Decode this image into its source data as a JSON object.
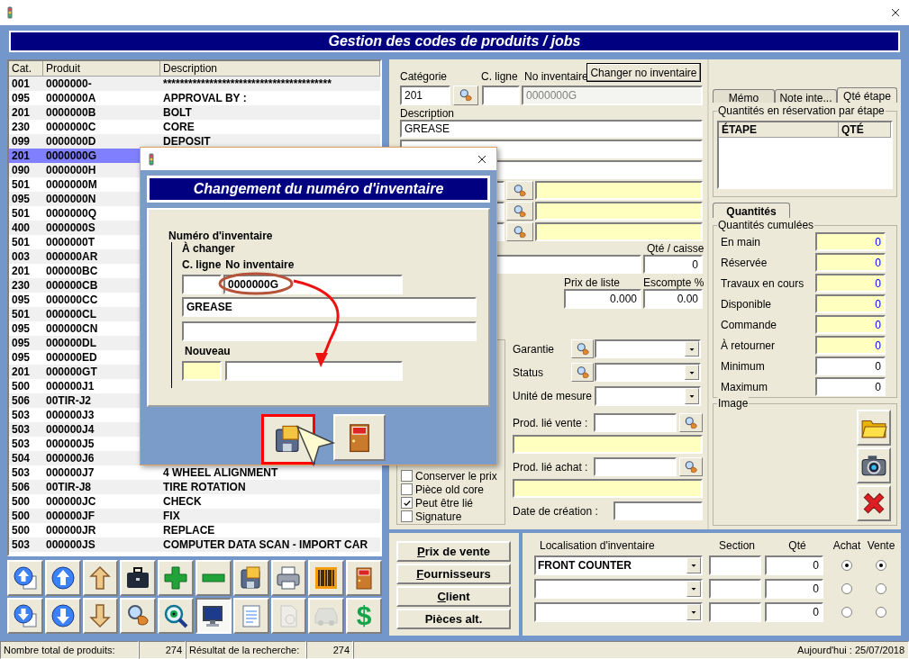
{
  "app_title": "Gestion des codes de produits / jobs",
  "product_table": {
    "columns": [
      "Cat.",
      "Produit",
      "Description"
    ],
    "rows": [
      {
        "cat": "001",
        "product": "0000000-",
        "description": "****************************************",
        "selected": false
      },
      {
        "cat": "095",
        "product": "0000000A",
        "description": "APPROVAL BY :",
        "selected": false
      },
      {
        "cat": "201",
        "product": "0000000B",
        "description": "BOLT",
        "selected": false
      },
      {
        "cat": "230",
        "product": "0000000C",
        "description": "CORE",
        "selected": false
      },
      {
        "cat": "099",
        "product": "0000000D",
        "description": "DEPOSIT",
        "selected": false
      },
      {
        "cat": "201",
        "product": "0000000G",
        "selected": true
      },
      {
        "cat": "090",
        "product": "0000000H",
        "selected": false
      },
      {
        "cat": "501",
        "product": "0000000M",
        "selected": false
      },
      {
        "cat": "095",
        "product": "0000000N",
        "selected": false
      },
      {
        "cat": "501",
        "product": "0000000Q",
        "selected": false
      },
      {
        "cat": "400",
        "product": "0000000S",
        "selected": false
      },
      {
        "cat": "501",
        "product": "0000000T",
        "selected": false
      },
      {
        "cat": "003",
        "product": "000000AR",
        "selected": false
      },
      {
        "cat": "201",
        "product": "000000BC",
        "selected": false
      },
      {
        "cat": "230",
        "product": "000000CB",
        "selected": false
      },
      {
        "cat": "095",
        "product": "000000CC",
        "selected": false
      },
      {
        "cat": "501",
        "product": "000000CL",
        "selected": false
      },
      {
        "cat": "095",
        "product": "000000CN",
        "selected": false
      },
      {
        "cat": "095",
        "product": "000000DL",
        "selected": false
      },
      {
        "cat": "095",
        "product": "000000ED",
        "selected": false
      },
      {
        "cat": "201",
        "product": "000000GT",
        "selected": false
      },
      {
        "cat": "500",
        "product": "000000J1",
        "selected": false
      },
      {
        "cat": "506",
        "product": "00TIR-J2",
        "selected": false
      },
      {
        "cat": "503",
        "product": "000000J3",
        "selected": false
      },
      {
        "cat": "503",
        "product": "000000J4",
        "selected": false
      },
      {
        "cat": "503",
        "product": "000000J5",
        "selected": false
      },
      {
        "cat": "504",
        "product": "000000J6",
        "selected": false
      },
      {
        "cat": "503",
        "product": "000000J7",
        "description": "4 WHEEL ALIGNMENT",
        "selected": false
      },
      {
        "cat": "506",
        "product": "00TIR-J8",
        "description": "TIRE ROTATION",
        "selected": false
      },
      {
        "cat": "500",
        "product": "000000JC",
        "description": "CHECK",
        "selected": false
      },
      {
        "cat": "500",
        "product": "000000JF",
        "description": "FIX",
        "selected": false
      },
      {
        "cat": "500",
        "product": "000000JR",
        "description": "REPLACE",
        "selected": false
      },
      {
        "cat": "503",
        "product": "000000JS",
        "description": "COMPUTER DATA SCAN - IMPORT CAR",
        "selected": false
      }
    ]
  },
  "toolbar": [
    [
      {
        "kind": "up-doc",
        "disabled": false,
        "pressed": false
      },
      {
        "kind": "up-circle",
        "disabled": false,
        "pressed": false
      },
      {
        "kind": "up-arrow",
        "disabled": false,
        "pressed": false
      },
      {
        "kind": "briefcase",
        "disabled": false,
        "pressed": false
      },
      {
        "kind": "plus",
        "disabled": false,
        "pressed": false
      },
      {
        "kind": "minus",
        "disabled": false,
        "pressed": false
      },
      {
        "kind": "floppy",
        "disabled": false,
        "pressed": false
      },
      {
        "kind": "printer",
        "disabled": false,
        "pressed": false
      },
      {
        "kind": "barcode",
        "disabled": false,
        "pressed": false
      },
      {
        "kind": "exit",
        "disabled": false,
        "pressed": false
      }
    ],
    [
      {
        "kind": "down-doc",
        "disabled": false,
        "pressed": false
      },
      {
        "kind": "down-circle",
        "disabled": false,
        "pressed": false
      },
      {
        "kind": "down-arrow",
        "disabled": false,
        "pressed": false
      },
      {
        "kind": "lookup",
        "disabled": false,
        "pressed": false
      },
      {
        "kind": "eye-search",
        "disabled": false,
        "pressed": false
      },
      {
        "kind": "monitor",
        "disabled": false,
        "pressed": true
      },
      {
        "kind": "notepad",
        "disabled": false,
        "pressed": false
      },
      {
        "kind": "document",
        "disabled": true,
        "pressed": false
      },
      {
        "kind": "car",
        "disabled": true,
        "pressed": false
      },
      {
        "kind": "dollar",
        "text": "$",
        "disabled": false,
        "pressed": false
      }
    ]
  ],
  "form": {
    "category": {
      "label": "Catégorie",
      "value": "201"
    },
    "line_code": {
      "label": "C. ligne"
    },
    "inventory_no": {
      "label": "No inventaire",
      "value": "0000000G",
      "disabled": true
    },
    "change_button": "Changer no inventaire",
    "description": {
      "label": "Description",
      "value": "GREASE"
    },
    "qty_per_case": {
      "label": "Qté / caisse",
      "value": "0"
    },
    "list_price": {
      "label": "Prix de liste",
      "value": "0.000"
    },
    "discount": {
      "label": "Escompte %",
      "value": "0.00"
    },
    "warranty": {
      "label": "Garantie"
    },
    "status": {
      "label": "Status"
    },
    "unit": {
      "label": "Unité de mesure"
    },
    "linked_sale": {
      "label": "Prod. lié vente :"
    },
    "linked_purchase": {
      "label": "Prod. lié achat :"
    },
    "creation_date": {
      "label": "Date de création :"
    },
    "options": [
      {
        "label": "Conserver le prix",
        "checked": false
      },
      {
        "label": "Pièce old core",
        "checked": false
      },
      {
        "label": "Peut être lié",
        "checked": true
      },
      {
        "label": "Signature",
        "checked": false
      }
    ]
  },
  "side_tabs": [
    {
      "label": "Mémo",
      "selected": false
    },
    {
      "label": "Note inte...",
      "selected": false
    },
    {
      "label": "Qté étape",
      "selected": true
    }
  ],
  "stage_group": {
    "title": "Quantités en réservation par étape",
    "columns": [
      "ÉTAPE",
      "QTÉ"
    ]
  },
  "qty_tabs": [
    {
      "label": "Quantités",
      "selected": true
    }
  ],
  "cumulative": {
    "title": "Quantités cumulées",
    "rows": [
      {
        "label": "En main",
        "value": "0",
        "kind": "computed"
      },
      {
        "label": "Réservée",
        "value": "0",
        "kind": "computed"
      },
      {
        "label": "Travaux en cours",
        "value": "0",
        "kind": "computed"
      },
      {
        "label": "Disponible",
        "value": "0",
        "kind": "computed"
      },
      {
        "label": "Commande",
        "value": "0",
        "kind": "computed"
      },
      {
        "label": "À retourner",
        "value": "0",
        "kind": "computed"
      },
      {
        "label": "Minimum",
        "value": "0",
        "kind": "editable"
      },
      {
        "label": "Maximum",
        "value": "0",
        "kind": "editable"
      }
    ]
  },
  "image": {
    "title": "Image",
    "buttons": [
      {
        "kind": "folder"
      },
      {
        "kind": "camera"
      },
      {
        "kind": "delete"
      }
    ]
  },
  "side_buttons": [
    {
      "label": "Prix de vente",
      "underline_first": true
    },
    {
      "label": "Fournisseurs",
      "underline_first": true
    },
    {
      "label": "Client",
      "underline_first": true
    },
    {
      "label": "Pièces alt.",
      "underline_first": false
    }
  ],
  "locations": {
    "columns": [
      "Localisation d'inventaire",
      "Section",
      "Qté",
      "Achat",
      "Vente"
    ],
    "rows": [
      {
        "location": "FRONT COUNTER",
        "qty": "0",
        "purchase": true,
        "sale": true
      },
      {
        "qty": "0",
        "purchase": false,
        "sale": false
      },
      {
        "qty": "0",
        "purchase": false,
        "sale": false
      }
    ]
  },
  "status_bar": {
    "cells": [
      {
        "label": "Nombre total de produits:",
        "value": "274"
      },
      {
        "label": "Résultat de la recherche:",
        "value": "274"
      }
    ],
    "today": "Aujourd'hui : 25/07/2018"
  },
  "dialog": {
    "title": "Changement du numéro d'inventaire",
    "group": "Numéro d'inventaire",
    "old_heading": "À changer",
    "col_line": "C. ligne",
    "col_inv": "No inventaire",
    "old_value": "0000000G",
    "old_description": "GREASE",
    "new_heading": "Nouveau"
  }
}
